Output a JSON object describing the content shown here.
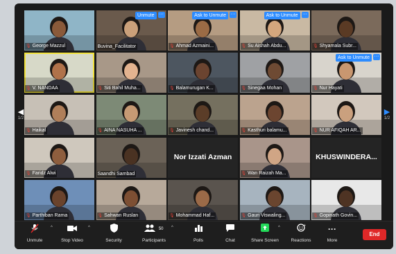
{
  "participants": [
    {
      "name": "George Mazzul",
      "bg": "#8fb5c7",
      "skin": "#8a5a3a",
      "muted": true
    },
    {
      "name": "Buvina_Facilitator",
      "bg": "#6a5a4c",
      "skin": "#caa07a",
      "muted": false,
      "badge": "Unmute"
    },
    {
      "name": "Ahmad Azmaini...",
      "bg": "#b59c82",
      "skin": "#9b6b45",
      "muted": true,
      "badge": "Ask to Unmute"
    },
    {
      "name": "Su Aishah Abdu...",
      "bg": "#c9b9a3",
      "skin": "#d4a67d",
      "muted": true,
      "badge": "Ask to Unmute"
    },
    {
      "name": "Shyamala Subr...",
      "bg": "#7b6a5b",
      "skin": "#5a3a24",
      "muted": true
    },
    {
      "name": "V. NANDAA",
      "bg": "#d7d9c8",
      "skin": "#b0724a",
      "muted": true,
      "active": true
    },
    {
      "name": "Siti Bahil Muha...",
      "bg": "#a89888",
      "skin": "#e3b38f",
      "muted": true
    },
    {
      "name": "Balamurugan K...",
      "bg": "#4d5660",
      "skin": "#6b4430",
      "muted": true
    },
    {
      "name": "Sinegaa Mohan",
      "bg": "#9fa1a4",
      "skin": "#6e4a33",
      "muted": true
    },
    {
      "name": "Nur Hayati",
      "bg": "#d8d4cc",
      "skin": "#c99770",
      "muted": true,
      "badge": "Ask to Unmute"
    },
    {
      "name": "Haikal",
      "bg": "#c7c0b6",
      "skin": "#b07f5a",
      "muted": true
    },
    {
      "name": "AINA NASUHA ...",
      "bg": "#7d8a76",
      "skin": "#c69a74",
      "muted": true
    },
    {
      "name": "Javinesh chand...",
      "bg": "#75705f",
      "skin": "#5b3d28",
      "muted": true
    },
    {
      "name": "Kasthuri balamu...",
      "bg": "#bba38e",
      "skin": "#6c4530",
      "muted": true
    },
    {
      "name": "NUR AFIQAH AR...",
      "bg": "#d2c8bd",
      "skin": "#caa07e",
      "muted": true
    },
    {
      "name": "Faridz Alwi",
      "bg": "#cfc8bd",
      "skin": "#8e5e3e",
      "muted": true
    },
    {
      "name": "Saandhi Sambad",
      "bg": "#6b6257",
      "skin": "#4a3222",
      "muted": false
    },
    {
      "name": "Nor Izzati Azman",
      "bg": "#242424",
      "muted": false,
      "nameonly": true
    },
    {
      "name": "Wan Raizah Ma...",
      "bg": "#a9958a",
      "skin": "#d0a585",
      "muted": true
    },
    {
      "name": "KHUSWINDERA...",
      "bg": "#242424",
      "muted": false,
      "nameonly": true
    },
    {
      "name": "Parthiban Rama",
      "bg": "#6e8fb8",
      "skin": "#6a432c",
      "muted": true
    },
    {
      "name": "Sahwan Ruslan",
      "bg": "#b7a99a",
      "skin": "#7d4f33",
      "muted": true
    },
    {
      "name": "Mohammad Haf...",
      "bg": "#5a544e",
      "skin": "#9b6a48",
      "muted": true
    },
    {
      "name": "Gauri Viswaling...",
      "bg": "#a7b4bf",
      "skin": "#6a452f",
      "muted": true
    },
    {
      "name": "Gopinath Govin...",
      "bg": "#e8e8e8",
      "skin": "#4e3323",
      "muted": true
    }
  ],
  "pager": {
    "label": "1/2"
  },
  "toolbar": {
    "unmute": "Unmute",
    "stop_video": "Stop Video",
    "security": "Security",
    "participants": "Participants",
    "participants_count": "50",
    "polls": "Polls",
    "chat": "Chat",
    "share_screen": "Share Screen",
    "reactions": "Reactions",
    "more": "More",
    "end": "End"
  }
}
